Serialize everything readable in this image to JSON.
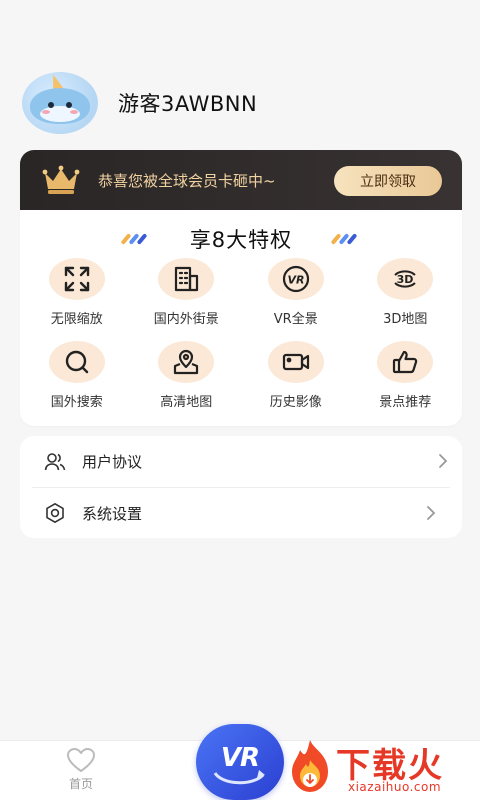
{
  "profile": {
    "username": "游客3AWBNN"
  },
  "vip": {
    "banner_text": "恭喜您被全球会员卡砸中~",
    "claim_label": "立即领取",
    "privileges_title": "享8大特权",
    "features": [
      {
        "label": "无限缩放",
        "icon": "fullscreen-icon"
      },
      {
        "label": "国内外街景",
        "icon": "building-icon"
      },
      {
        "label": "VR全景",
        "icon": "vr-icon"
      },
      {
        "label": "3D地图",
        "icon": "3d-icon"
      },
      {
        "label": "国外搜索",
        "icon": "search-icon"
      },
      {
        "label": "高清地图",
        "icon": "map-pin-icon"
      },
      {
        "label": "历史影像",
        "icon": "video-camera-icon"
      },
      {
        "label": "景点推荐",
        "icon": "thumbs-up-icon"
      }
    ]
  },
  "settings": {
    "items": [
      {
        "label": "用户协议",
        "icon": "users-icon"
      },
      {
        "label": "系统设置",
        "icon": "gear-icon"
      }
    ]
  },
  "tabbar": {
    "home_label": "首页",
    "vr_label": "VR"
  },
  "watermark": {
    "title": "下载火",
    "subtitle": "xiazaihuo.com"
  },
  "colors": {
    "banner_bg": "#2f2a2a",
    "gold_text": "#f1d3a2",
    "icon_bg": "#fbe8d6",
    "brand_blue": "#3a55e4",
    "watermark_red": "#e63826"
  }
}
